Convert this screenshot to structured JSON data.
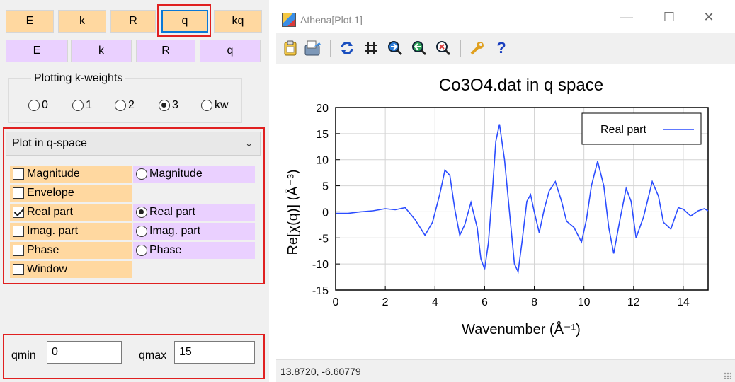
{
  "left_panel": {
    "row1_buttons": [
      {
        "label": "E",
        "variant": "orange"
      },
      {
        "label": "k",
        "variant": "orange"
      },
      {
        "label": "R",
        "variant": "orange"
      },
      {
        "label": "q",
        "variant": "orange",
        "selected": true
      },
      {
        "label": "kq",
        "variant": "orange"
      }
    ],
    "row2_buttons": [
      {
        "label": "E",
        "variant": "violet"
      },
      {
        "label": "k",
        "variant": "violet"
      },
      {
        "label": "R",
        "variant": "violet"
      },
      {
        "label": "q",
        "variant": "violet"
      }
    ],
    "kweights": {
      "title": "Plotting k-weights",
      "options": [
        "0",
        "1",
        "2",
        "3",
        "kw"
      ],
      "selected": "3"
    },
    "plot_select": {
      "value": "Plot in q-space"
    },
    "single_plot_options": [
      {
        "label": "Magnitude",
        "checked": false
      },
      {
        "label": "Envelope",
        "checked": false
      },
      {
        "label": "Real part",
        "checked": true
      },
      {
        "label": "Imag. part",
        "checked": false
      },
      {
        "label": "Phase",
        "checked": false
      },
      {
        "label": "Window",
        "checked": false
      }
    ],
    "multi_plot_options": [
      {
        "label": "Magnitude",
        "selected": false
      },
      {
        "label": "Real part",
        "selected": true
      },
      {
        "label": "Imag. part",
        "selected": false
      },
      {
        "label": "Phase",
        "selected": false
      }
    ],
    "qmin": {
      "label": "qmin",
      "value": "0"
    },
    "qmax": {
      "label": "qmax",
      "value": "15"
    }
  },
  "window": {
    "title": "Athena[Plot.1]",
    "controls": [
      "minimize",
      "maximize",
      "close"
    ],
    "toolbar": [
      "clipboard-icon",
      "save-icon",
      "refresh-icon",
      "grid-icon",
      "zoom-in-icon",
      "zoom-out-icon",
      "zoom-reset-icon",
      "settings-icon",
      "help-icon"
    ],
    "status_text": "13.8720, -6.60779"
  },
  "chart_data": {
    "type": "line",
    "title": "Co3O4.dat in q space",
    "xlabel": "Wavenumber   (Å⁻¹)",
    "ylabel": "Re[χ(q)]   (Å⁻³)",
    "xlim": [
      0,
      15
    ],
    "ylim": [
      -15,
      20
    ],
    "xticks": [
      0,
      2,
      4,
      6,
      8,
      10,
      12,
      14
    ],
    "yticks": [
      -15,
      -10,
      -5,
      0,
      5,
      10,
      15,
      20
    ],
    "grid": true,
    "legend": "top-right",
    "series": [
      {
        "name": "Real part",
        "color": "#2b4dff",
        "x": [
          0,
          0.5,
          1.0,
          1.5,
          2.0,
          2.4,
          2.8,
          3.2,
          3.6,
          3.9,
          4.2,
          4.4,
          4.6,
          4.8,
          5.0,
          5.2,
          5.45,
          5.7,
          5.85,
          6.0,
          6.15,
          6.3,
          6.45,
          6.6,
          6.8,
          7.0,
          7.2,
          7.35,
          7.5,
          7.7,
          7.85,
          8.0,
          8.2,
          8.4,
          8.6,
          8.85,
          9.1,
          9.3,
          9.6,
          9.9,
          10.1,
          10.3,
          10.55,
          10.8,
          11.0,
          11.2,
          11.45,
          11.7,
          11.9,
          12.1,
          12.4,
          12.75,
          13.0,
          13.2,
          13.5,
          13.8,
          14.0,
          14.3,
          14.6,
          14.85,
          15.0
        ],
        "y": [
          -0.3,
          -0.3,
          0.0,
          0.2,
          0.6,
          0.4,
          0.8,
          -1.5,
          -4.5,
          -2.0,
          3.5,
          8.0,
          7.0,
          0.5,
          -4.5,
          -2.5,
          1.8,
          -3.0,
          -9.0,
          -11.0,
          -6.0,
          3.0,
          13.5,
          16.8,
          10.0,
          0.0,
          -10.0,
          -11.5,
          -6.0,
          2.0,
          3.3,
          0.0,
          -4.0,
          0.5,
          4.0,
          5.8,
          2.0,
          -1.8,
          -3.0,
          -5.8,
          -1.5,
          5.0,
          9.7,
          5.0,
          -3.0,
          -8.0,
          -1.5,
          4.5,
          2.0,
          -5.0,
          -1.0,
          5.8,
          3.0,
          -2.0,
          -3.3,
          0.8,
          0.5,
          -0.8,
          0.2,
          0.6,
          0.2
        ]
      }
    ]
  }
}
